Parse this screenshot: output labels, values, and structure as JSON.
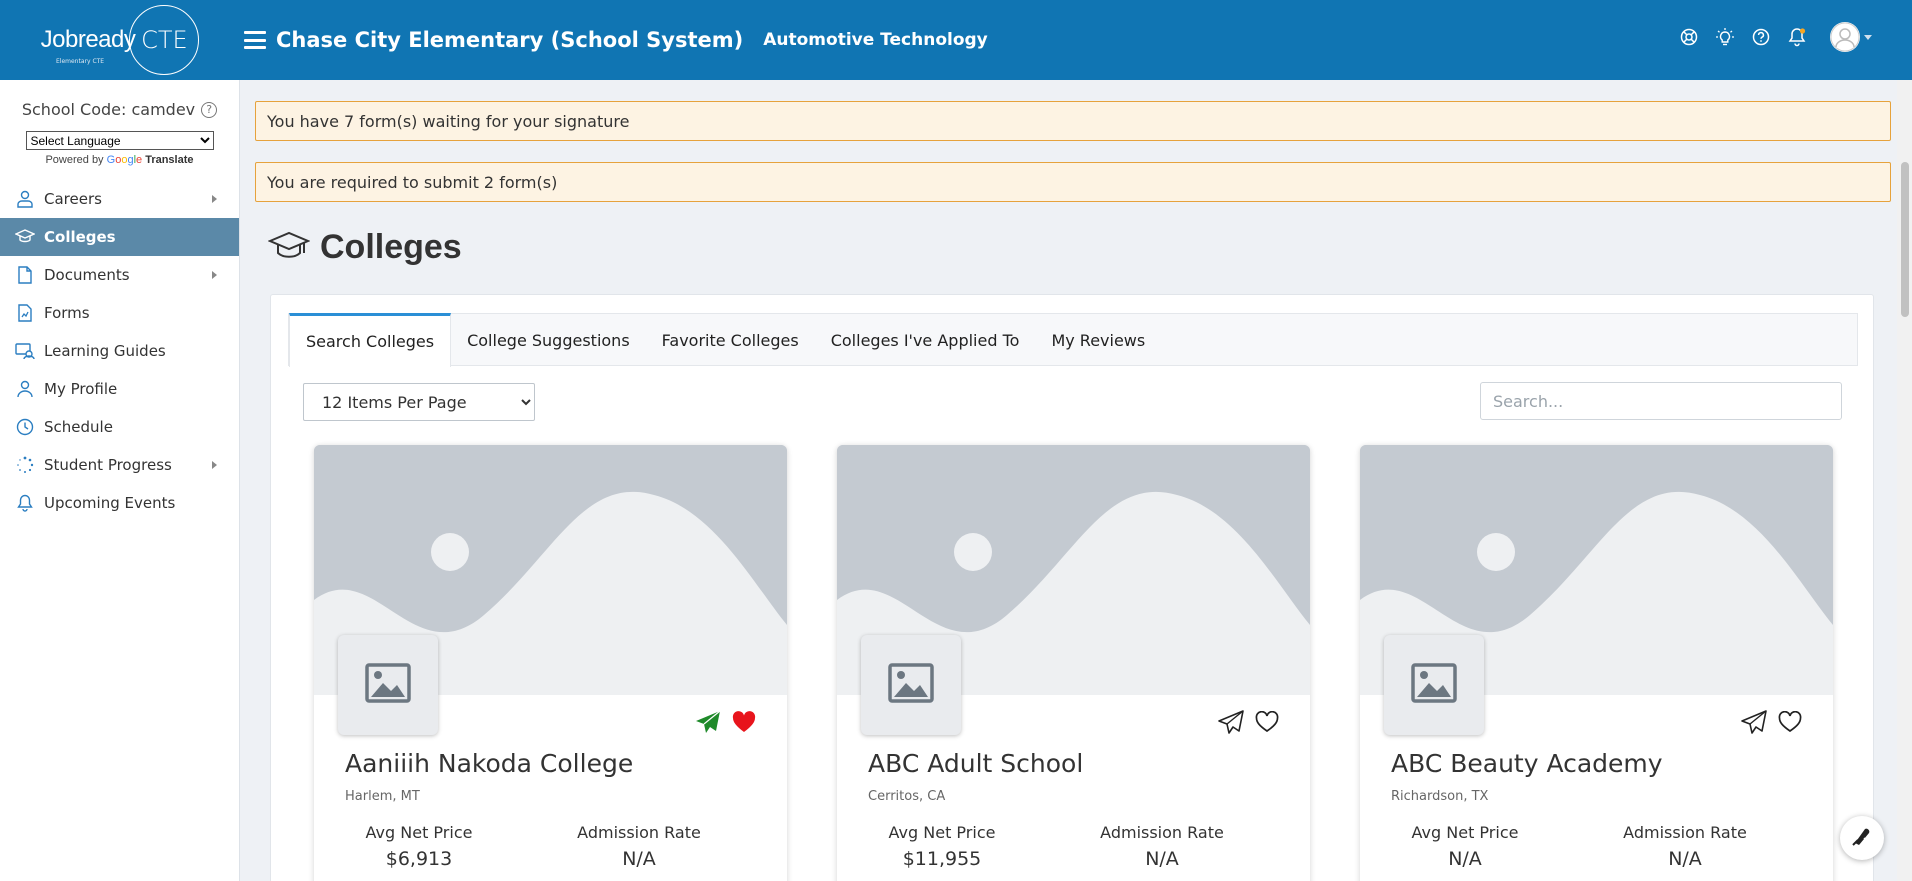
{
  "header": {
    "logo_text": "Jobready",
    "logo_cte": "CTE",
    "logo_sub": "Elementary CTE",
    "school": "Chase City Elementary (School System)",
    "program": "Automotive Technology"
  },
  "sidebar": {
    "school_code": "School Code: camdev",
    "language_select": "Select Language",
    "powered_by": "Powered by",
    "google_letters": [
      "G",
      "o",
      "o",
      "g",
      "l",
      "e"
    ],
    "translate": "Translate",
    "items": [
      {
        "label": "Careers",
        "icon": "careers-icon",
        "has_arrow": true
      },
      {
        "label": "Colleges",
        "icon": "graduation-cap-icon",
        "active": true
      },
      {
        "label": "Documents",
        "icon": "document-icon",
        "has_arrow": true
      },
      {
        "label": "Forms",
        "icon": "form-icon"
      },
      {
        "label": "Learning Guides",
        "icon": "learning-guides-icon"
      },
      {
        "label": "My Profile",
        "icon": "user-icon"
      },
      {
        "label": "Schedule",
        "icon": "clock-icon"
      },
      {
        "label": "Student Progress",
        "icon": "progress-icon",
        "has_arrow": true
      },
      {
        "label": "Upcoming Events",
        "icon": "bell-icon"
      }
    ]
  },
  "alerts": {
    "signature": "You have 7 form(s) waiting for your signature",
    "submit": "You are required to submit 2 form(s)"
  },
  "page": {
    "title": "Colleges"
  },
  "tabs": [
    "Search Colleges",
    "College Suggestions",
    "Favorite Colleges",
    "Colleges I've Applied To",
    "My Reviews"
  ],
  "controls": {
    "per_page": "12 Items Per Page",
    "search_placeholder": "Search..."
  },
  "cards": [
    {
      "name": "Aaniiih Nakoda College",
      "location": "Harlem, MT",
      "net_price_label": "Avg Net Price",
      "net_price": "$6,913",
      "admission_label": "Admission Rate",
      "admission": "N/A",
      "applied": true,
      "favorite": true
    },
    {
      "name": "ABC Adult School",
      "location": "Cerritos, CA",
      "net_price_label": "Avg Net Price",
      "net_price": "$11,955",
      "admission_label": "Admission Rate",
      "admission": "N/A",
      "applied": false,
      "favorite": false
    },
    {
      "name": "ABC Beauty Academy",
      "location": "Richardson, TX",
      "net_price_label": "Avg Net Price",
      "net_price": "N/A",
      "admission_label": "Admission Rate",
      "admission": "N/A",
      "applied": false,
      "favorite": false
    }
  ],
  "colors": {
    "header_bg": "#1075b3",
    "active_nav": "#5b89a8",
    "applied_green": "#1f8a2a",
    "favorite_red": "#e8141c",
    "alert_bg": "#fdf3e3",
    "alert_border": "#e6a23c"
  }
}
